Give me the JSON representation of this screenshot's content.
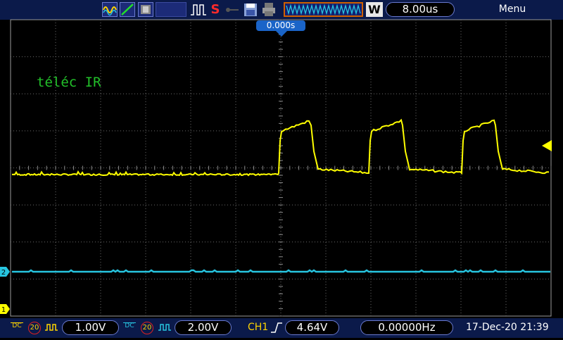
{
  "topbar": {
    "stop_letter": "S",
    "memory_mode": "W",
    "timebase": "8.00us",
    "menu_label": "Menu",
    "trigger_position": "0.000s"
  },
  "screen": {
    "label": "téléc IR",
    "ch1_marker": "1",
    "ch2_marker": "2"
  },
  "bottombar": {
    "ch1": {
      "coupling": "DC",
      "bw_limit": "20",
      "volts_per_div": "1.00V"
    },
    "ch2": {
      "coupling": "DC",
      "bw_limit": "20",
      "volts_per_div": "2.00V"
    },
    "trigger_source": "CH1",
    "trigger_level": "4.64V",
    "frequency": "0.00000Hz",
    "datetime": "17-Dec-20 21:39"
  },
  "colors": {
    "background": "#000000",
    "bar": "#0b1a4a",
    "ch1": "#ffff00",
    "ch2": "#27c5e0",
    "label": "#22c02a",
    "accent": "#1a64c8"
  }
}
